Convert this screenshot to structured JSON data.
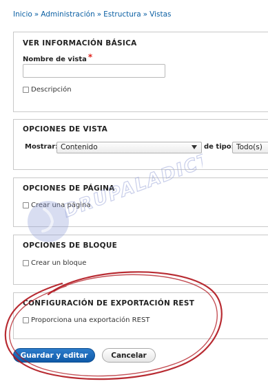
{
  "breadcrumb": {
    "items": [
      "Inicio",
      "Administración",
      "Estructura",
      "Vistas"
    ],
    "separator": "»"
  },
  "basic_info": {
    "legend": "VER INFORMACIÓN BÁSICA",
    "name_label": "Nombre de vista",
    "required_mark": "*",
    "name_value": "",
    "description_label": "Descripción"
  },
  "view_settings": {
    "legend": "OPCIONES DE VISTA",
    "show_label": "Mostrar:",
    "show_value": "Contenido",
    "type_label": "de tipo:",
    "type_value": "Todo(s)"
  },
  "page_settings": {
    "legend": "OPCIONES DE PÁGINA",
    "checkbox_label": "Crear una página"
  },
  "block_settings": {
    "legend": "OPCIONES DE BLOQUE",
    "checkbox_label": "Crear un bloque"
  },
  "rest_settings": {
    "legend": "CONFIGURACIÓN DE EXPORTACIÓN REST",
    "checkbox_label": "Proporciona una exportación REST"
  },
  "actions": {
    "save_label": "Guardar y editar",
    "cancel_label": "Cancelar"
  },
  "watermark": {
    "text": "DRUPALADICTO"
  },
  "colors": {
    "link": "#0a5fa3",
    "primary_button": "#1a66b5",
    "required": "#e0221b",
    "annotation": "#b0141c"
  }
}
